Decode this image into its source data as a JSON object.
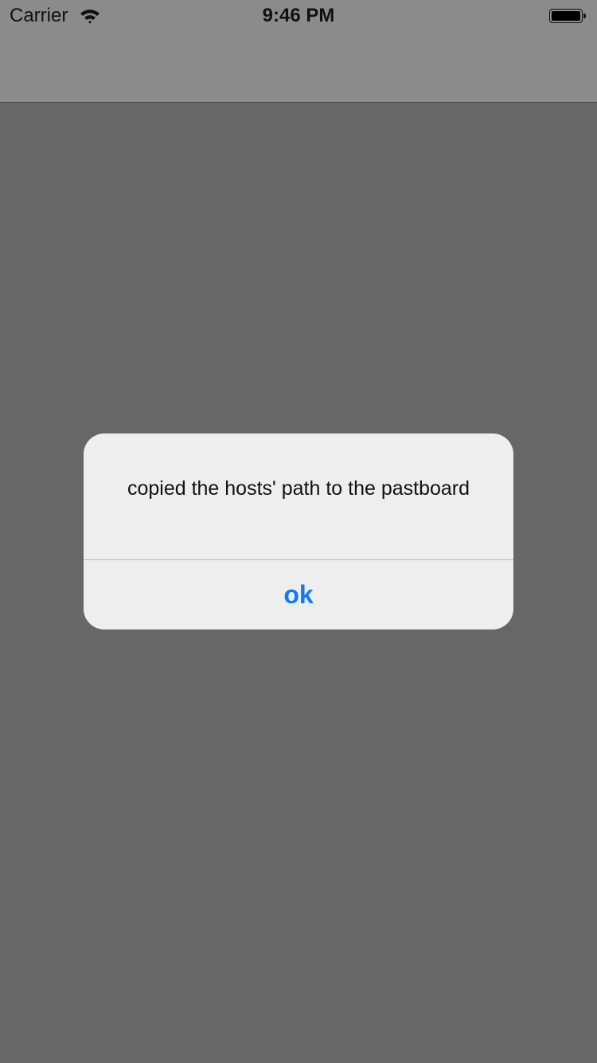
{
  "status_bar": {
    "carrier": "Carrier",
    "time": "9:46 PM",
    "wifi_icon": "wifi-icon",
    "battery_icon": "battery-icon",
    "battery_level": 1.0
  },
  "alert": {
    "message": "copied the hosts' path to the pastboard",
    "ok_label": "ok",
    "accent_color": "#0a7aff"
  }
}
